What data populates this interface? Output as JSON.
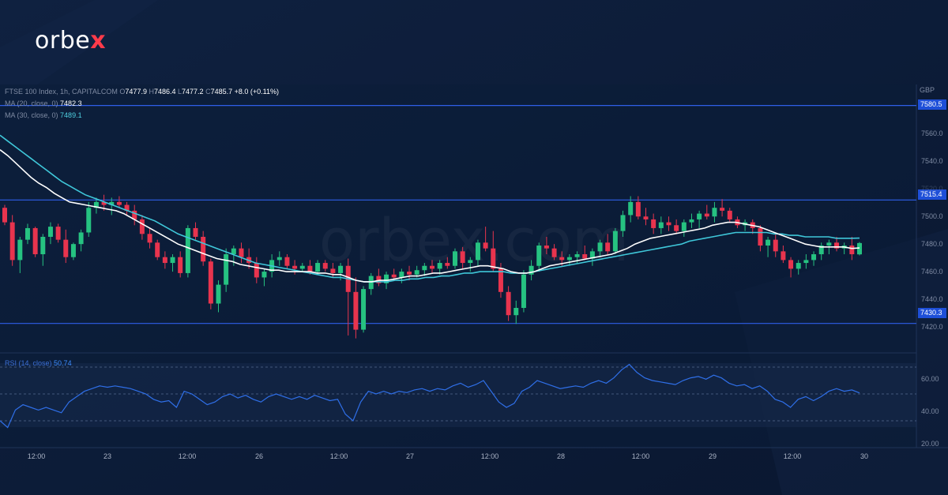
{
  "brand": {
    "logo_text": "orbe",
    "logo_accent": "x",
    "watermark": "orbex.com",
    "accent_color": "#ff3b4a"
  },
  "legend": {
    "symbol": "FTSE 100 Index, 1h, CAPITALCOM",
    "open_label": "O",
    "open": "7477.9",
    "high_label": "H",
    "high": "7486.4",
    "low_label": "L",
    "low": "7477.2",
    "close_label": "C",
    "close": "7485.7",
    "change": "+8.0 (+0.11%)",
    "ma20_label": "MA (20, close, 0)",
    "ma20_value": "7482.3",
    "ma30_label": "MA (30, close, 0)",
    "ma30_value": "7489.1"
  },
  "currency": "GBP",
  "levels": [
    {
      "value": "7580.5",
      "price": 7580.5
    },
    {
      "value": "7515.4",
      "price": 7515.4
    },
    {
      "value": "7430.3",
      "price": 7430.3
    }
  ],
  "price_axis": [
    "7560.0",
    "7540.0",
    "7520.0",
    "7500.0",
    "7480.0",
    "7460.0",
    "7440.0",
    "7420.0"
  ],
  "rsi": {
    "label": "RSI (14, close)",
    "value": "50.74",
    "axis": [
      "60.00",
      "40.00",
      "20.00"
    ]
  },
  "time_axis": [
    "12:00",
    "23",
    "12:00",
    "26",
    "12:00",
    "27",
    "12:00",
    "28",
    "12:00",
    "29",
    "12:00",
    "30"
  ],
  "colors": {
    "up": "#26c281",
    "down": "#e8344e",
    "ma20": "#ffffff",
    "ma30": "#3fc7d9",
    "level": "#2f5fe8",
    "rsi": "#2f6fe8"
  },
  "chart_data": {
    "type": "candlestick",
    "title": "FTSE 100 Index, 1h, CAPITALCOM",
    "ylim": [
      7410,
      7595
    ],
    "rsi_ylim": [
      10,
      80
    ],
    "candles": [
      [
        7510,
        7512,
        7498,
        7500
      ],
      [
        7500,
        7505,
        7470,
        7474
      ],
      [
        7474,
        7490,
        7465,
        7488
      ],
      [
        7488,
        7499,
        7485,
        7496
      ],
      [
        7496,
        7497,
        7476,
        7478
      ],
      [
        7478,
        7492,
        7470,
        7490
      ],
      [
        7490,
        7500,
        7485,
        7497
      ],
      [
        7497,
        7499,
        7486,
        7488
      ],
      [
        7488,
        7495,
        7472,
        7476
      ],
      [
        7476,
        7486,
        7474,
        7485
      ],
      [
        7485,
        7495,
        7480,
        7493
      ],
      [
        7493,
        7514,
        7490,
        7510
      ],
      [
        7510,
        7517,
        7506,
        7514
      ],
      [
        7514,
        7519,
        7508,
        7512
      ],
      [
        7512,
        7517,
        7505,
        7514
      ],
      [
        7514,
        7518,
        7510,
        7512
      ],
      [
        7512,
        7514,
        7505,
        7508
      ],
      [
        7508,
        7512,
        7498,
        7502
      ],
      [
        7502,
        7505,
        7488,
        7492
      ],
      [
        7492,
        7496,
        7482,
        7486
      ],
      [
        7486,
        7488,
        7474,
        7476
      ],
      [
        7476,
        7480,
        7468,
        7472
      ],
      [
        7472,
        7478,
        7466,
        7476
      ],
      [
        7476,
        7480,
        7462,
        7465
      ],
      [
        7465,
        7498,
        7462,
        7496
      ],
      [
        7496,
        7500,
        7488,
        7490
      ],
      [
        7490,
        7494,
        7470,
        7473
      ],
      [
        7473,
        7475,
        7440,
        7444
      ],
      [
        7444,
        7460,
        7438,
        7457
      ],
      [
        7457,
        7482,
        7452,
        7478
      ],
      [
        7478,
        7484,
        7470,
        7482
      ],
      [
        7482,
        7486,
        7472,
        7476
      ],
      [
        7476,
        7482,
        7468,
        7472
      ],
      [
        7472,
        7476,
        7458,
        7462
      ],
      [
        7462,
        7468,
        7456,
        7466
      ],
      [
        7466,
        7478,
        7462,
        7474
      ],
      [
        7474,
        7480,
        7470,
        7476
      ],
      [
        7476,
        7478,
        7468,
        7470
      ],
      [
        7470,
        7474,
        7464,
        7468
      ],
      [
        7468,
        7472,
        7466,
        7470
      ],
      [
        7470,
        7474,
        7464,
        7466
      ],
      [
        7466,
        7474,
        7464,
        7472
      ],
      [
        7472,
        7474,
        7466,
        7468
      ],
      [
        7468,
        7472,
        7462,
        7465
      ],
      [
        7465,
        7472,
        7460,
        7470
      ],
      [
        7470,
        7475,
        7422,
        7452
      ],
      [
        7452,
        7462,
        7420,
        7426
      ],
      [
        7426,
        7456,
        7424,
        7454
      ],
      [
        7454,
        7465,
        7450,
        7463
      ],
      [
        7463,
        7468,
        7456,
        7458
      ],
      [
        7458,
        7466,
        7454,
        7464
      ],
      [
        7464,
        7468,
        7460,
        7462
      ],
      [
        7462,
        7468,
        7458,
        7466
      ],
      [
        7466,
        7470,
        7460,
        7464
      ],
      [
        7464,
        7470,
        7462,
        7467
      ],
      [
        7467,
        7472,
        7463,
        7470
      ],
      [
        7470,
        7474,
        7465,
        7468
      ],
      [
        7468,
        7474,
        7464,
        7472
      ],
      [
        7472,
        7476,
        7468,
        7470
      ],
      [
        7470,
        7482,
        7468,
        7480
      ],
      [
        7480,
        7483,
        7468,
        7472
      ],
      [
        7472,
        7476,
        7466,
        7474
      ],
      [
        7474,
        7488,
        7470,
        7486
      ],
      [
        7486,
        7497,
        7480,
        7482
      ],
      [
        7482,
        7494,
        7466,
        7468
      ],
      [
        7468,
        7472,
        7448,
        7452
      ],
      [
        7452,
        7456,
        7432,
        7436
      ],
      [
        7436,
        7446,
        7430,
        7441
      ],
      [
        7441,
        7467,
        7438,
        7464
      ],
      [
        7464,
        7474,
        7460,
        7470
      ],
      [
        7470,
        7486,
        7466,
        7484
      ],
      [
        7484,
        7490,
        7478,
        7482
      ],
      [
        7482,
        7485,
        7474,
        7476
      ],
      [
        7476,
        7480,
        7470,
        7474
      ],
      [
        7474,
        7478,
        7470,
        7476
      ],
      [
        7476,
        7480,
        7472,
        7478
      ],
      [
        7478,
        7484,
        7474,
        7475
      ],
      [
        7475,
        7482,
        7470,
        7480
      ],
      [
        7480,
        7488,
        7476,
        7486
      ],
      [
        7486,
        7492,
        7478,
        7480
      ],
      [
        7480,
        7496,
        7478,
        7494
      ],
      [
        7494,
        7508,
        7490,
        7505
      ],
      [
        7505,
        7518,
        7500,
        7514
      ],
      [
        7514,
        7518,
        7502,
        7504
      ],
      [
        7504,
        7510,
        7498,
        7502
      ],
      [
        7502,
        7506,
        7492,
        7496
      ],
      [
        7496,
        7504,
        7492,
        7500
      ],
      [
        7500,
        7504,
        7494,
        7498
      ],
      [
        7498,
        7502,
        7492,
        7494
      ],
      [
        7494,
        7502,
        7490,
        7500
      ],
      [
        7500,
        7506,
        7496,
        7502
      ],
      [
        7502,
        7508,
        7496,
        7506
      ],
      [
        7506,
        7512,
        7502,
        7504
      ],
      [
        7504,
        7514,
        7500,
        7510
      ],
      [
        7510,
        7516,
        7504,
        7508
      ],
      [
        7508,
        7510,
        7500,
        7502
      ],
      [
        7502,
        7504,
        7496,
        7498
      ],
      [
        7498,
        7502,
        7494,
        7500
      ],
      [
        7500,
        7502,
        7492,
        7496
      ],
      [
        7496,
        7498,
        7480,
        7484
      ],
      [
        7484,
        7490,
        7476,
        7488
      ],
      [
        7488,
        7492,
        7476,
        7480
      ],
      [
        7480,
        7484,
        7472,
        7474
      ],
      [
        7474,
        7476,
        7462,
        7468
      ],
      [
        7468,
        7474,
        7464,
        7472
      ],
      [
        7472,
        7478,
        7468,
        7474
      ],
      [
        7474,
        7480,
        7470,
        7478
      ],
      [
        7478,
        7486,
        7474,
        7484
      ],
      [
        7484,
        7488,
        7478,
        7486
      ],
      [
        7486,
        7490,
        7480,
        7482
      ],
      [
        7482,
        7486,
        7478,
        7484
      ],
      [
        7484,
        7490,
        7474,
        7478
      ],
      [
        7477.9,
        7486.4,
        7477.2,
        7485.7
      ]
    ],
    "ma20": [
      7550,
      7546,
      7541,
      7536,
      7531,
      7527,
      7524,
      7520,
      7517,
      7514,
      7513,
      7512,
      7511,
      7510,
      7509,
      7508,
      7506,
      7503,
      7500,
      7497,
      7494,
      7491,
      7488,
      7485,
      7483,
      7481,
      7479,
      7477,
      7475,
      7474,
      7473,
      7471,
      7470,
      7469,
      7468,
      7467,
      7467,
      7466,
      7466,
      7466,
      7466,
      7465,
      7465,
      7464,
      7464,
      7462,
      7460,
      7459,
      7459,
      7460,
      7460,
      7461,
      7462,
      7463,
      7463,
      7464,
      7465,
      7465,
      7466,
      7467,
      7468,
      7469,
      7470,
      7470,
      7469,
      7468,
      7466,
      7465,
      7465,
      7466,
      7468,
      7470,
      7471,
      7472,
      7473,
      7474,
      7475,
      7476,
      7477,
      7478,
      7480,
      7482,
      7485,
      7487,
      7489,
      7490,
      7491,
      7492,
      7493,
      7494,
      7495,
      7496,
      7498,
      7499,
      7500,
      7500,
      7499,
      7498,
      7497,
      7495,
      7493,
      7491,
      7489,
      7487,
      7485,
      7484,
      7483,
      7483,
      7483,
      7483,
      7482,
      7482.3
    ],
    "ma30": [
      7560,
      7556,
      7552,
      7548,
      7544,
      7540,
      7536,
      7532,
      7528,
      7525,
      7522,
      7519,
      7517,
      7515,
      7513,
      7511,
      7509,
      7507,
      7505,
      7503,
      7501,
      7498,
      7495,
      7492,
      7490,
      7488,
      7486,
      7484,
      7482,
      7480,
      7478,
      7476,
      7474,
      7472,
      7471,
      7470,
      7469,
      7468,
      7467,
      7466,
      7465,
      7464,
      7463,
      7462,
      7462,
      7461,
      7460,
      7459,
      7459,
      7459,
      7459,
      7460,
      7460,
      7461,
      7461,
      7462,
      7462,
      7463,
      7463,
      7464,
      7465,
      7465,
      7466,
      7466,
      7466,
      7466,
      7465,
      7465,
      7465,
      7466,
      7467,
      7468,
      7469,
      7470,
      7471,
      7472,
      7473,
      7474,
      7475,
      7476,
      7477,
      7478,
      7479,
      7480,
      7481,
      7482,
      7483,
      7484,
      7485,
      7487,
      7488,
      7489,
      7490,
      7491,
      7492,
      7493,
      7493,
      7493,
      7493,
      7493,
      7492,
      7492,
      7491,
      7491,
      7490,
      7490,
      7490,
      7490,
      7489,
      7489,
      7489,
      7489.1
    ],
    "rsi": [
      30,
      25,
      38,
      42,
      40,
      38,
      40,
      38,
      36,
      44,
      48,
      52,
      54,
      56,
      55,
      56,
      55,
      54,
      52,
      50,
      46,
      44,
      45,
      40,
      52,
      50,
      46,
      42,
      44,
      48,
      50,
      47,
      49,
      46,
      44,
      48,
      50,
      48,
      46,
      48,
      46,
      49,
      47,
      45,
      46,
      35,
      30,
      44,
      52,
      50,
      52,
      50,
      52,
      51,
      53,
      54,
      52,
      54,
      53,
      56,
      58,
      55,
      57,
      60,
      52,
      44,
      40,
      43,
      52,
      55,
      60,
      58,
      56,
      54,
      55,
      56,
      55,
      58,
      60,
      58,
      62,
      68,
      72,
      66,
      62,
      60,
      59,
      58,
      57,
      60,
      62,
      63,
      61,
      64,
      62,
      58,
      56,
      57,
      54,
      56,
      52,
      46,
      44,
      40,
      46,
      48,
      45,
      48,
      52,
      54,
      52,
      53,
      50.74
    ]
  }
}
